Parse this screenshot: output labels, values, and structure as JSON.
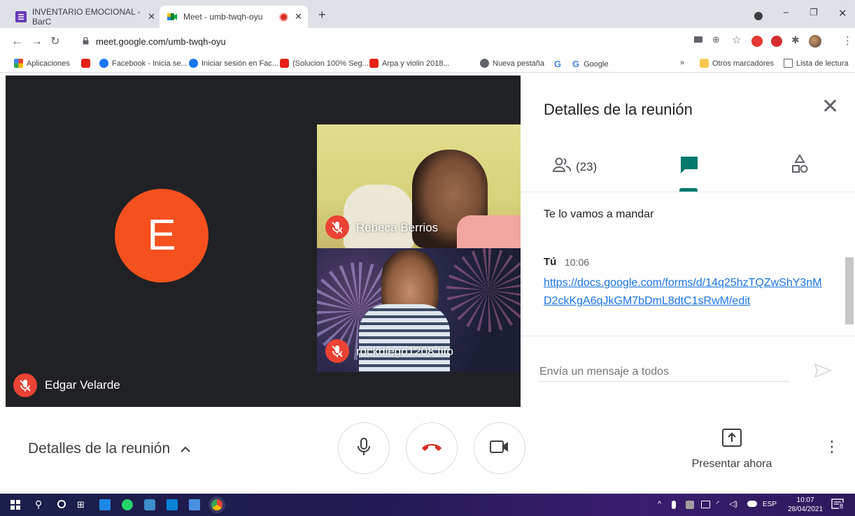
{
  "browser": {
    "tabs": [
      {
        "title": "INVENTARIO EMOCIONAL - BarC",
        "favicon": "forms-icon",
        "color": "#673ab7"
      },
      {
        "title": "Meet - umb-twqh-oyu",
        "favicon": "meet-icon",
        "color": "#00832d"
      }
    ],
    "new_tab": "+",
    "url": "meet.google.com/umb-twqh-oyu",
    "bookmarks": [
      {
        "label": "Aplicaciones",
        "icon": "apps-grid-icon"
      },
      {
        "label": "",
        "icon": "youtube-icon"
      },
      {
        "label": "Facebook - Inicia se...",
        "icon": "facebook-icon"
      },
      {
        "label": "Iniciar sesión en Fac...",
        "icon": "facebook-icon"
      },
      {
        "label": "(Solucion 100% Seg...",
        "icon": "youtube-icon"
      },
      {
        "label": "Arpa y violin 2018...",
        "icon": "youtube-icon"
      },
      {
        "label": "Nueva pestaña",
        "icon": "chrome-icon"
      },
      {
        "label": "G",
        "icon": "google-icon"
      },
      {
        "label": "Google",
        "icon": "google-icon"
      }
    ],
    "bookmarks_more": "»",
    "other_bookmarks": "Otros marcadores",
    "reading_list": "Lista de lectura"
  },
  "meet": {
    "main_participant": {
      "name": "Edgar Velarde",
      "initial": "E",
      "avatar_color": "#f4511e"
    },
    "tiles": [
      {
        "name": "Rebeca Berrios"
      },
      {
        "name": "rockdiego1208 tito"
      }
    ],
    "panel": {
      "title": "Detalles de la reunión",
      "people_count": "(23)",
      "messages": [
        {
          "text": "Te lo vamos a mandar"
        },
        {
          "sender": "Tú",
          "time": "10:06",
          "link": "https://docs.google.com/forms/d/14q25hzTQZwShY3nMD2ckKgA6qJkGM7bDmL8dtC1sRwM/edit"
        }
      ],
      "input_placeholder": "Envía un mensaje a todos"
    },
    "controls": {
      "details_label": "Detalles de la reunión",
      "present_label": "Presentar ahora"
    }
  },
  "taskbar": {
    "language": "ESP",
    "time": "10:07",
    "date": "28/04/2021",
    "notifications": "8"
  }
}
